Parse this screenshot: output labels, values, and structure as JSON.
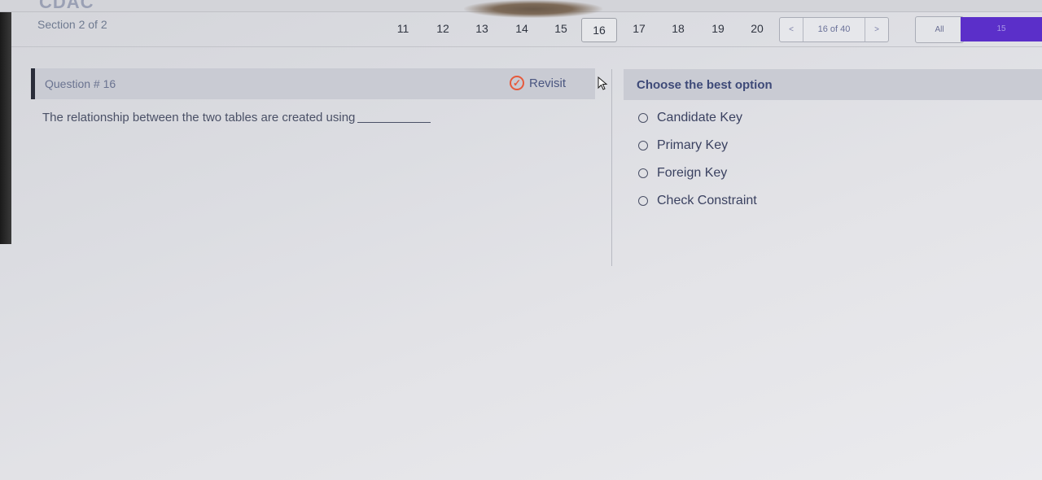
{
  "header": {
    "logo_text": "CDAC",
    "section_label": "Section 2 of 2",
    "page_numbers": [
      "11",
      "12",
      "13",
      "14",
      "15",
      "16",
      "17",
      "18",
      "19",
      "20"
    ],
    "active_page": "16",
    "pager": {
      "prev_label": "<",
      "count_label": "16 of 40",
      "next_label": ">"
    },
    "all_label": "All",
    "purple_label": "15"
  },
  "question": {
    "label": "Question # 16",
    "revisit_label": "Revisit",
    "text": "The relationship between the two tables are created using"
  },
  "answers": {
    "title": "Choose the best option",
    "options": [
      "Candidate Key",
      "Primary Key",
      "Foreign Key",
      "Check Constraint"
    ]
  },
  "colors": {
    "accent_purple": "#5b2fc9",
    "revisit_red": "#e65a3c",
    "header_gray": "#c9cbd3"
  }
}
